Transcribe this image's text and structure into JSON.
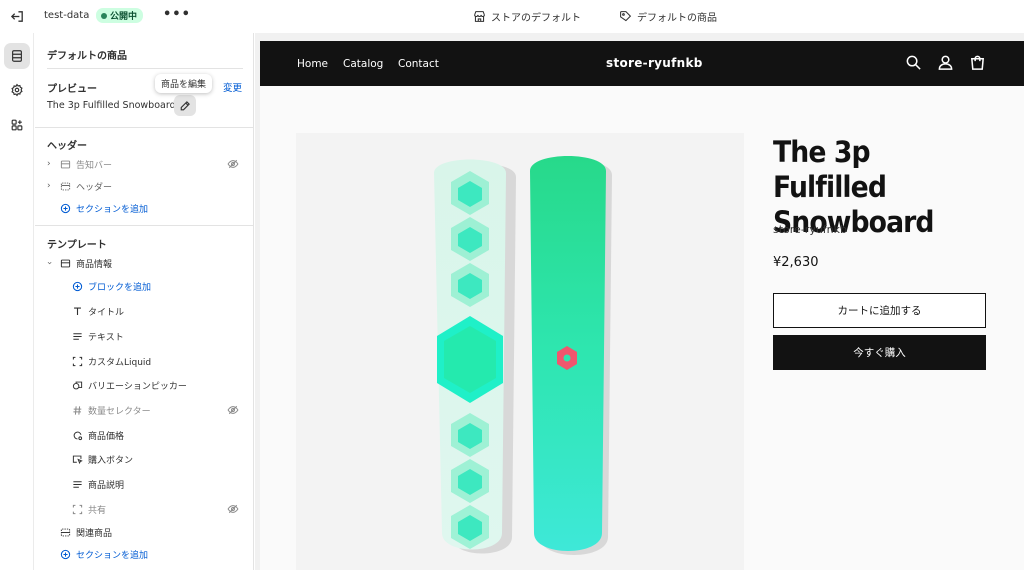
{
  "topbar": {
    "store_name": "test-data",
    "status": "公開中",
    "more": "•••",
    "theme_link": "ストアのデフォルト",
    "template_link": "デフォルトの商品"
  },
  "panel": {
    "title": "デフォルトの商品",
    "preview": {
      "heading": "プレビュー",
      "change": "変更",
      "item": "The 3p Fulfilled Snowboard",
      "tooltip": "商品を編集"
    },
    "header_group": {
      "heading": "ヘッダー",
      "items": [
        "告知バー",
        "ヘッダー"
      ],
      "add_section": "セクションを追加"
    },
    "template_group": {
      "heading": "テンプレート",
      "section": "商品情報",
      "add_block": "ブロックを追加",
      "blocks": [
        "タイトル",
        "テキスト",
        "カスタムLiquid",
        "バリエーションピッカー",
        "数量セレクター",
        "商品価格",
        "購入ボタン",
        "商品説明",
        "共有"
      ],
      "related": "関連商品",
      "add_section": "セクションを追加"
    }
  },
  "store": {
    "nav": [
      "Home",
      "Catalog",
      "Contact"
    ],
    "logo": "store-ryufnkb",
    "product": {
      "title": "The 3p Fulfilled Snowboard",
      "vendor": "store-ryufnkb",
      "price": "¥2,630",
      "add_to_cart": "カートに追加する",
      "buy_now": "今すぐ購入"
    }
  },
  "colors": {
    "accent": "#005bd3",
    "store_header": "#121212",
    "board_mint": "#2ee6b0",
    "badge_bg": "#cdfee1"
  }
}
